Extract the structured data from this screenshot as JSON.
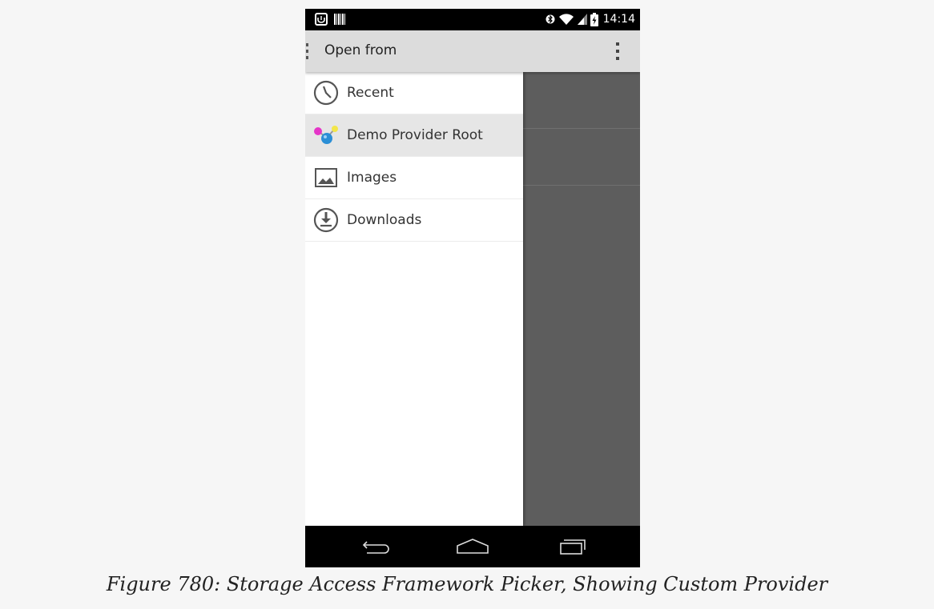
{
  "status_bar": {
    "time": "14:14",
    "left_icons": [
      "notification-app-icon",
      "barcode-icon"
    ],
    "right_icons": [
      "bluetooth-icon",
      "wifi-icon",
      "signal-icon",
      "battery-charging-icon"
    ]
  },
  "action_bar": {
    "title": "Open from",
    "overflow_icon": "overflow-menu-icon"
  },
  "drawer": {
    "roots": [
      {
        "label": "Recent",
        "icon": "clock-icon",
        "selected": false
      },
      {
        "label": "Demo Provider Root",
        "icon": "molecule-icon",
        "selected": true
      },
      {
        "label": "Images",
        "icon": "image-icon",
        "selected": false
      },
      {
        "label": "Downloads",
        "icon": "download-icon",
        "selected": false
      }
    ]
  },
  "nav_bar": {
    "buttons": [
      "back-icon",
      "home-icon",
      "recents-icon"
    ]
  },
  "caption": "Figure 780: Storage Access Framework Picker, Showing Custom Provider"
}
